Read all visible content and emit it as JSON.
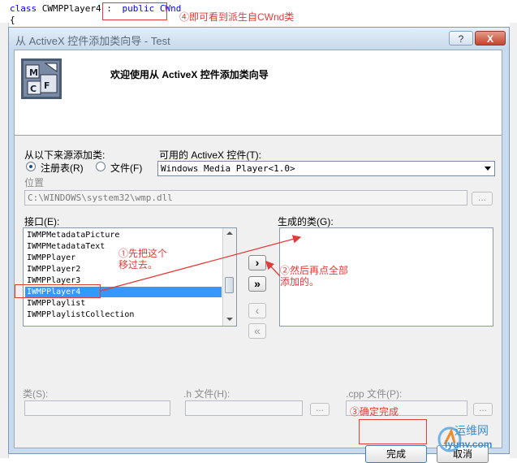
{
  "editor": {
    "code_prefix": "class CWMPPlayer4 :",
    "code_base": "public CWnd",
    "brace": "{",
    "note": "④即可看到派生自CWnd类"
  },
  "dialog": {
    "title": "从 ActiveX 控件添加类向导 - Test",
    "help_label": "?",
    "close_label": "X",
    "welcome": "欢迎使用从 ActiveX 控件添加类向导",
    "source_label": "从以下来源添加类:",
    "radio_registry": "注册表(R)",
    "radio_file": "文件(F)",
    "available_label": "可用的 ActiveX 控件(T):",
    "available_value": "Windows Media Player<1.0>",
    "location_label": "位置",
    "location_value": "C:\\WINDOWS\\system32\\wmp.dll",
    "browse_label": "...",
    "interfaces_label": "接口(E):",
    "interfaces": [
      "IWMPMetadataPicture",
      "IWMPMetadataText",
      "IWMPPlayer",
      "IWMPPlayer2",
      "IWMPPlayer3",
      "IWMPPlayer4",
      "IWMPPlaylist",
      "IWMPPlaylistCollection"
    ],
    "generated_label": "生成的类(G):",
    "add_one": "›",
    "add_all": "»",
    "remove_one": "‹",
    "remove_all": "«",
    "class_label": "类(S):",
    "h_file_label": ".h 文件(H):",
    "cpp_file_label": ".cpp 文件(P):",
    "finish_label": "完成",
    "cancel_label": "取消"
  },
  "annotations": {
    "step1_line1": "①先把这个",
    "step1_line2": "移过去。",
    "step2_line1": "②然后再点全部",
    "step2_line2": "添加的。",
    "step3": "③确定完成"
  },
  "watermark": {
    "text1": "运维网",
    "text2": "iyunv.com"
  },
  "colors": {
    "annotation": "#e23b3b",
    "selection": "#3399ff",
    "title_bar": "#c7d9ec"
  }
}
